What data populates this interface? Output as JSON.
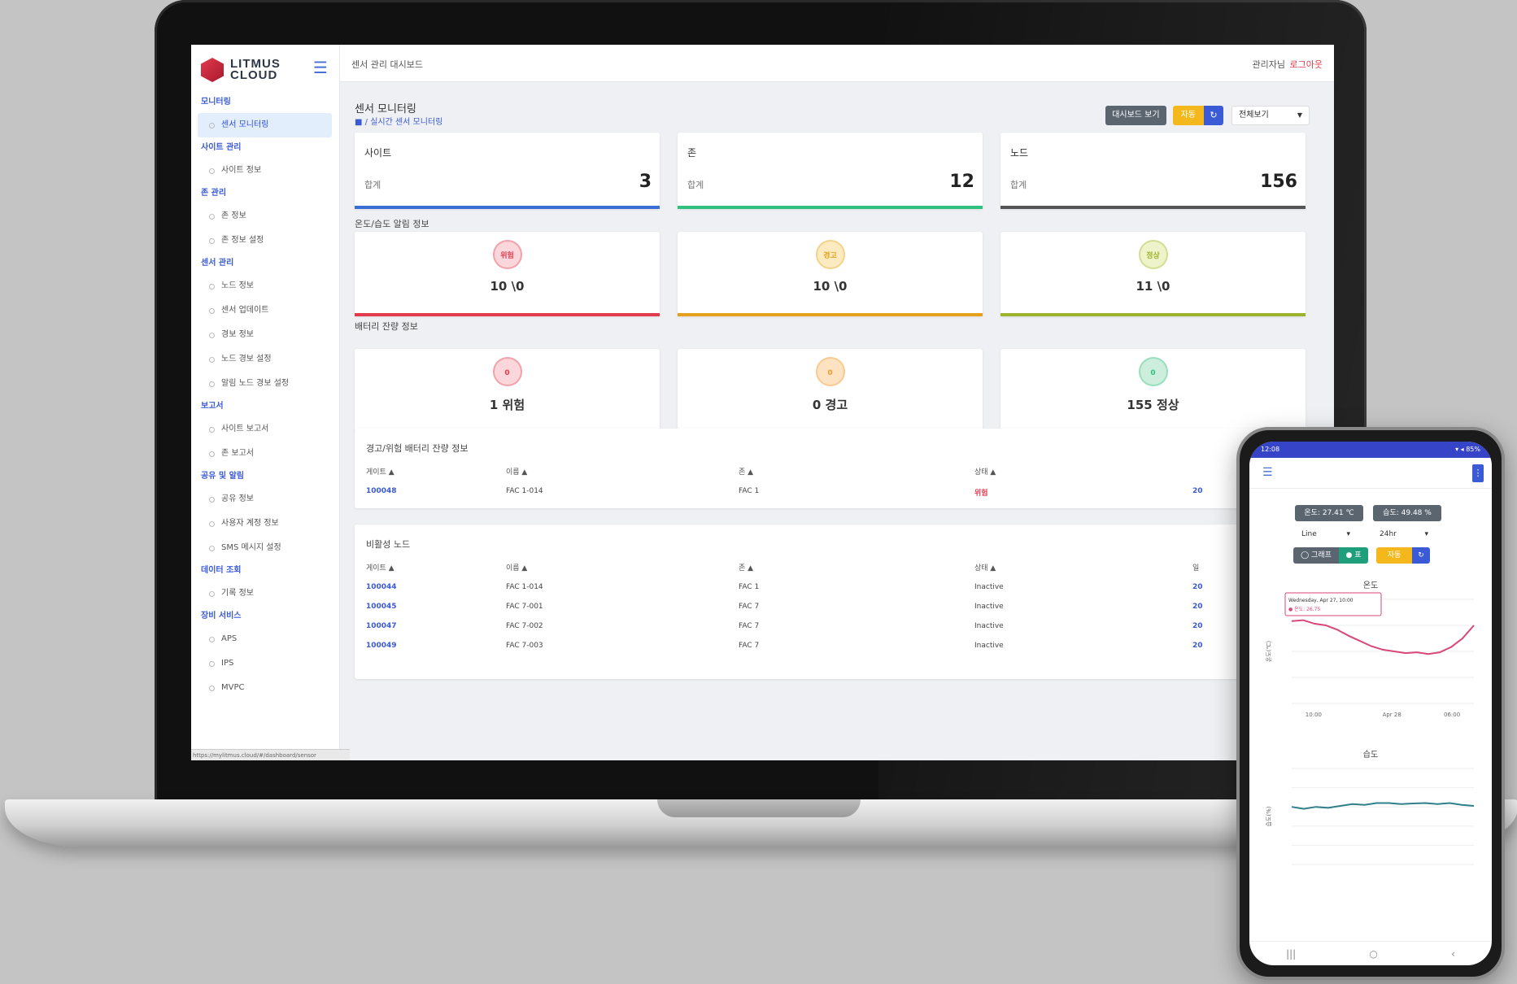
{
  "app": {
    "logo": "LITMUS CLOUD",
    "title": "센서 관리 대시보드",
    "user": "관리자님",
    "logout": "로그아웃",
    "status_url": "https://mylitmus.cloud/#/dashboard/sensor"
  },
  "sidebar": {
    "groups": [
      {
        "label": "모니터링",
        "items": [
          "센서 모니터링"
        ]
      },
      {
        "label": "사이트 관리",
        "items": [
          "사이트 정보"
        ]
      },
      {
        "label": "존 관리",
        "items": [
          "존 정보",
          "존 정보 설정"
        ]
      },
      {
        "label": "센서 관리",
        "items": [
          "노드 정보",
          "센서 업데이트",
          "경보 정보",
          "노드 경보 설정",
          "알림 노드 경보 설정"
        ]
      },
      {
        "label": "보고서",
        "items": [
          "사이트 보고서",
          "존 보고서"
        ]
      },
      {
        "label": "공유 및 알림",
        "items": [
          "공유 정보",
          "사용자 계정 정보",
          "SMS 메시지 설정"
        ]
      },
      {
        "label": "데이터 조회",
        "items": [
          "기록 정보"
        ]
      },
      {
        "label": "장비 서비스",
        "items": [
          "APS",
          "IPS",
          "MVPC"
        ]
      }
    ]
  },
  "header": {
    "page_title": "센서 모니터링",
    "breadcrumb": "/ 실시간 센서 모니터링",
    "btn_dashboard": "대시보드 보기",
    "btn_auto": "자동",
    "btn_refresh": "↻",
    "select_value": "전체보기"
  },
  "stats": [
    {
      "title": "사이트",
      "label": "합계",
      "value": "3",
      "color": "#3b6fd6"
    },
    {
      "title": "존",
      "label": "합계",
      "value": "12",
      "color": "#2ec27e"
    },
    {
      "title": "노드",
      "label": "합계",
      "value": "156",
      "color": "#555555"
    }
  ],
  "temp_section": {
    "label": "온도/습도 알림 정보",
    "cards": [
      {
        "badge": "위험",
        "value": "10 \\0",
        "color": "#e23b4e",
        "bg": "#fbd6da"
      },
      {
        "badge": "경고",
        "value": "10 \\0",
        "color": "#e5a11d",
        "bg": "#fcebc0"
      },
      {
        "badge": "정상",
        "value": "11 \\0",
        "color": "#9db32b",
        "bg": "#eef3c9"
      }
    ]
  },
  "battery_section": {
    "label": "배터리 잔량 정보",
    "cards": [
      {
        "badge": "0",
        "value": "1 위험",
        "color": "#e23b4e",
        "bg": "#fbd6da"
      },
      {
        "badge": "0",
        "value": "0 경고",
        "color": "#f29a2e",
        "bg": "#fde3c2"
      },
      {
        "badge": "0",
        "value": "155 정상",
        "color": "#2ec27e",
        "bg": "#cdeedd"
      }
    ]
  },
  "battery_table": {
    "title": "경고/위험 배터리 잔량 정보",
    "columns": [
      "게이트 ▲",
      "이름 ▲",
      "존 ▲",
      "상태 ▲"
    ],
    "rows": [
      {
        "gate": "100048",
        "name": "FAC 1-014",
        "zone": "FAC 1",
        "status": "위험",
        "extra": "20"
      }
    ]
  },
  "inactive_table": {
    "title": "비활성 노드",
    "columns": [
      "게이트 ▲",
      "이름 ▲",
      "존 ▲",
      "상태 ▲",
      "일"
    ],
    "rows": [
      {
        "gate": "100044",
        "name": "FAC 1-014",
        "zone": "FAC 1",
        "status": "Inactive",
        "extra": "20"
      },
      {
        "gate": "100045",
        "name": "FAC 7-001",
        "zone": "FAC 7",
        "status": "Inactive",
        "extra": "20"
      },
      {
        "gate": "100047",
        "name": "FAC 7-002",
        "zone": "FAC 7",
        "status": "Inactive",
        "extra": "20"
      },
      {
        "gate": "100049",
        "name": "FAC 7-003",
        "zone": "FAC 7",
        "status": "Inactive",
        "extra": "20"
      }
    ]
  },
  "phone": {
    "status_time": "12:08",
    "status_right": "▾ ◂ 85%",
    "chip_temp": "온도: 27.41 ℃",
    "chip_hum": "습도: 49.48 %",
    "select_1": "Line",
    "select_2": "24hr",
    "btn_graph": "그래프",
    "btn_table": "표",
    "btn_auto": "자동",
    "btn_refresh": "↻",
    "chart1_title": "온도",
    "chart1_ylabel": "온도(℃)",
    "chart1_tooltip_date": "Wednesday, Apr 27, 10:00",
    "chart1_tooltip_val": "● 온도: 26.75",
    "chart1_xticks": [
      "10:00",
      "Apr 28",
      "06:00"
    ],
    "chart2_title": "습도",
    "chart2_ylabel": "습도(%)",
    "nav": [
      "|||",
      "○",
      "‹"
    ]
  },
  "colors": {
    "primary": "#3b5bd6",
    "danger": "#e23b4e",
    "warning": "#f4b81c",
    "success": "#2ec27e",
    "temp_line": "#d9467a",
    "hum_line": "#2f7f8a"
  },
  "chart_data": [
    {
      "type": "line",
      "title": "온도",
      "ylabel": "온도(℃)",
      "x": [
        "10:00",
        "",
        "",
        "",
        "",
        "",
        "",
        "",
        "",
        "Apr 28",
        "",
        "",
        "",
        "",
        "06:00",
        "",
        ""
      ],
      "series": [
        {
          "values": [
            27.5,
            27.6,
            27.2,
            27.0,
            26.5,
            25.8,
            25.2,
            24.6,
            24.2,
            24.0,
            23.8,
            23.9,
            23.7,
            23.9,
            24.5,
            25.5,
            27.0
          ]
        }
      ]
    },
    {
      "type": "line",
      "title": "습도",
      "ylabel": "습도(%)",
      "series": [
        {
          "values": [
            50,
            49,
            50,
            49.5,
            50.5,
            51.5,
            51,
            52,
            52,
            51.5,
            51.8,
            52,
            51.5,
            52,
            51,
            50.5
          ]
        }
      ]
    }
  ]
}
